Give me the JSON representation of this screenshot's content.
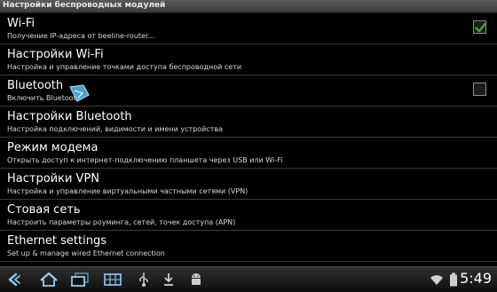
{
  "header": {
    "title": "Настройки беспроводных модулей"
  },
  "items": [
    {
      "title": "Wi-Fi",
      "subtitle": "Получение IP-адреса от beeline-router...",
      "checked": true
    },
    {
      "title": "Настройки Wi-Fi",
      "subtitle": "Настройка и управление точками доступа беспроводной сети"
    },
    {
      "title": "Bluetooth",
      "subtitle": "Включить Bluetooth",
      "checked": false
    },
    {
      "title": "Настройки Bluetooth",
      "subtitle": "Настройка подключений, видимости и имени устройства"
    },
    {
      "title": "Режим модема",
      "subtitle": "Открыть доступ к интернет-подключению планшета через USB или Wi-Fi"
    },
    {
      "title": "Настройки VPN",
      "subtitle": "Настройка и управление виртуальными частными сетями (VPN)"
    },
    {
      "title": "Стовая сеть",
      "subtitle": "Настроить параметры роуминга, сетей, точек доступа (APN)"
    },
    {
      "title": "Ethernet settings",
      "subtitle": "Set up & manage wired Ethernet connection"
    }
  ],
  "statusbar": {
    "time": "5:49"
  },
  "icons": {
    "back": "back-icon",
    "home": "home-icon",
    "recent": "recent-apps-icon",
    "screenshot": "screenshot-icon",
    "usb": "usb-icon",
    "download": "download-icon",
    "android": "android-debug-icon",
    "wifi": "wifi-signal-icon",
    "battery": "battery-icon"
  },
  "colors": {
    "check": "#3fae2a",
    "accent": "#4fb3e8",
    "divider": "#3a3a3a"
  }
}
